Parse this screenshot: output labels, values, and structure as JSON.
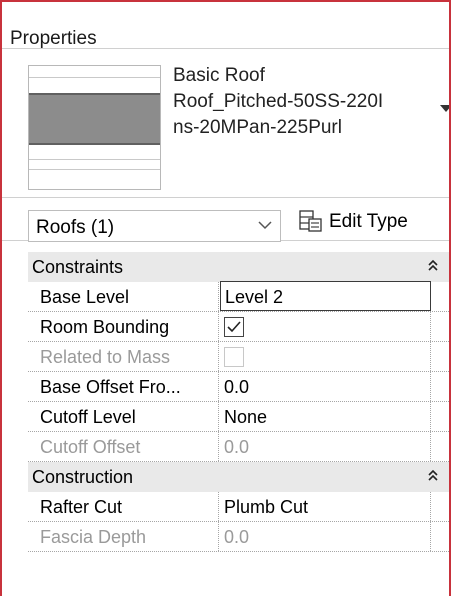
{
  "panel": {
    "title": "Properties"
  },
  "type_selector": {
    "family": "Basic Roof",
    "type_line1": "Roof_Pitched-50SS-220I",
    "type_line2": "ns-20MPan-225Purl",
    "dropdown_icon": "triangle-down-icon"
  },
  "category_selector": {
    "value": "Roofs (1)",
    "arrow_icon": "chevron-down-icon"
  },
  "edit_type": {
    "label": "Edit Type",
    "icon": "edit-type-icon"
  },
  "groups": [
    {
      "label": "Constraints",
      "collapse_icon": "double-chevron-up-icon",
      "rows": [
        {
          "name": "Base Level",
          "value": "Level 2",
          "kind": "input",
          "enabled": true
        },
        {
          "name": "Room Bounding",
          "value": "",
          "kind": "checkbox",
          "checked": true,
          "enabled": true
        },
        {
          "name": "Related to Mass",
          "value": "",
          "kind": "checkbox",
          "checked": false,
          "enabled": false
        },
        {
          "name": "Base Offset Fro...",
          "value": "0.0",
          "kind": "text",
          "enabled": true
        },
        {
          "name": "Cutoff Level",
          "value": "None",
          "kind": "text",
          "enabled": true
        },
        {
          "name": "Cutoff Offset",
          "value": "0.0",
          "kind": "text",
          "enabled": false
        }
      ]
    },
    {
      "label": "Construction",
      "collapse_icon": "double-chevron-up-icon",
      "rows": [
        {
          "name": "Rafter Cut",
          "value": "Plumb Cut",
          "kind": "text",
          "enabled": true
        },
        {
          "name": "Fascia Depth",
          "value": "0.0",
          "kind": "text",
          "enabled": false
        }
      ]
    }
  ],
  "colors": {
    "frame_border": "#c8323c",
    "group_header_bg": "#e9e9e9",
    "disabled_text": "#9a9a9a"
  }
}
